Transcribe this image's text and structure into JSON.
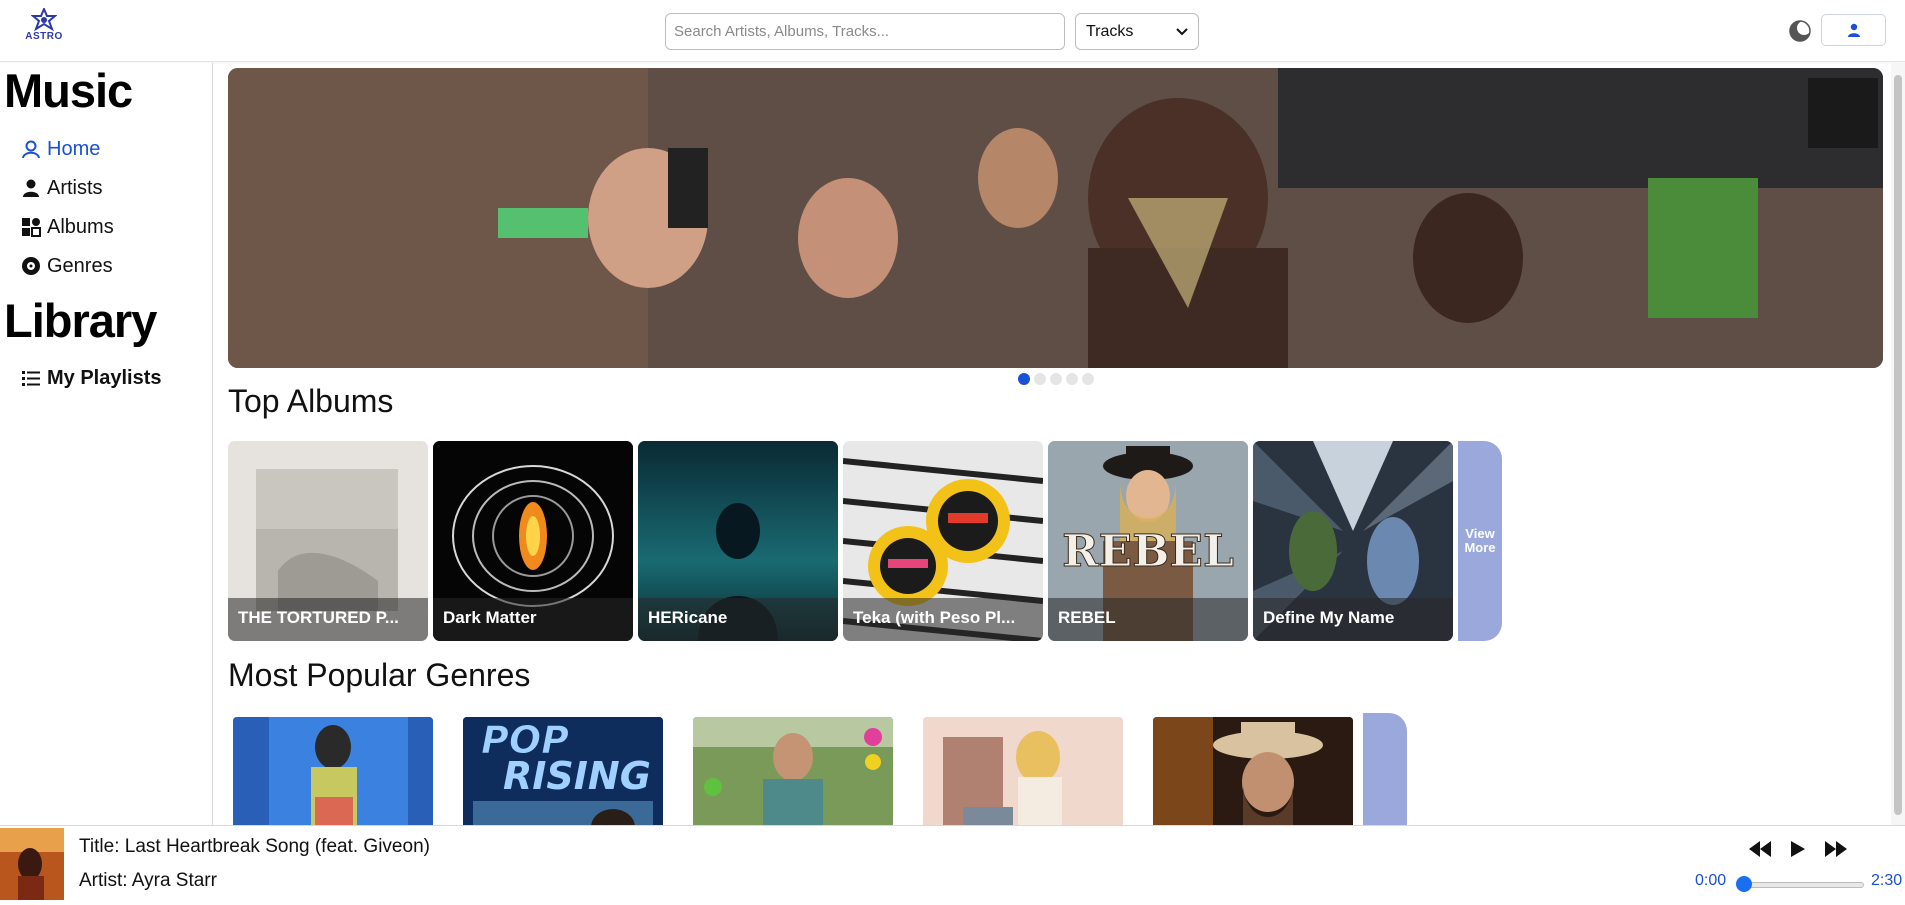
{
  "header": {
    "logo_text": "ASTRO",
    "search_placeholder": "Search Artists, Albums, Tracks...",
    "search_type": "Tracks"
  },
  "sidebar": {
    "music_heading": "Music",
    "library_heading": "Library",
    "items": [
      {
        "label": "Home",
        "icon": "user-circle-icon",
        "active": true
      },
      {
        "label": "Artists",
        "icon": "person-icon",
        "active": false
      },
      {
        "label": "Albums",
        "icon": "albums-icon",
        "active": false
      },
      {
        "label": "Genres",
        "icon": "record-icon",
        "active": false
      }
    ],
    "library_items": [
      {
        "label": "My Playlists",
        "icon": "list-icon"
      }
    ]
  },
  "main": {
    "carousel_slides": 5,
    "carousel_active": 1,
    "top_albums_title": "Top Albums",
    "albums": [
      {
        "title": "THE TORTURED POETS DEPARTMENT",
        "caption": "THE TORTURED P..."
      },
      {
        "title": "Dark Matter",
        "caption": "Dark Matter"
      },
      {
        "title": "HERicane",
        "caption": "HERicane"
      },
      {
        "title": "Teka (with Peso Pluma)",
        "caption": "Teka (with Peso Pl..."
      },
      {
        "title": "REBEL",
        "caption": "REBEL"
      },
      {
        "title": "Define My Name",
        "caption": "Define My Name"
      }
    ],
    "view_more_label": "View More",
    "genres_title": "Most Popular Genres",
    "genre_cards": [
      "hits-usa",
      "pop-rising",
      "indie",
      "pop",
      "country"
    ]
  },
  "player": {
    "title_line": "Title: Last Heartbreak Song (feat. Giveon)",
    "artist_line": "Artist: Ayra Starr",
    "time_current": "0:00",
    "time_total": "2:30",
    "progress": 0
  },
  "colors": {
    "accent": "#1a4fd8",
    "view_more_bg": "#9aa8dc"
  }
}
